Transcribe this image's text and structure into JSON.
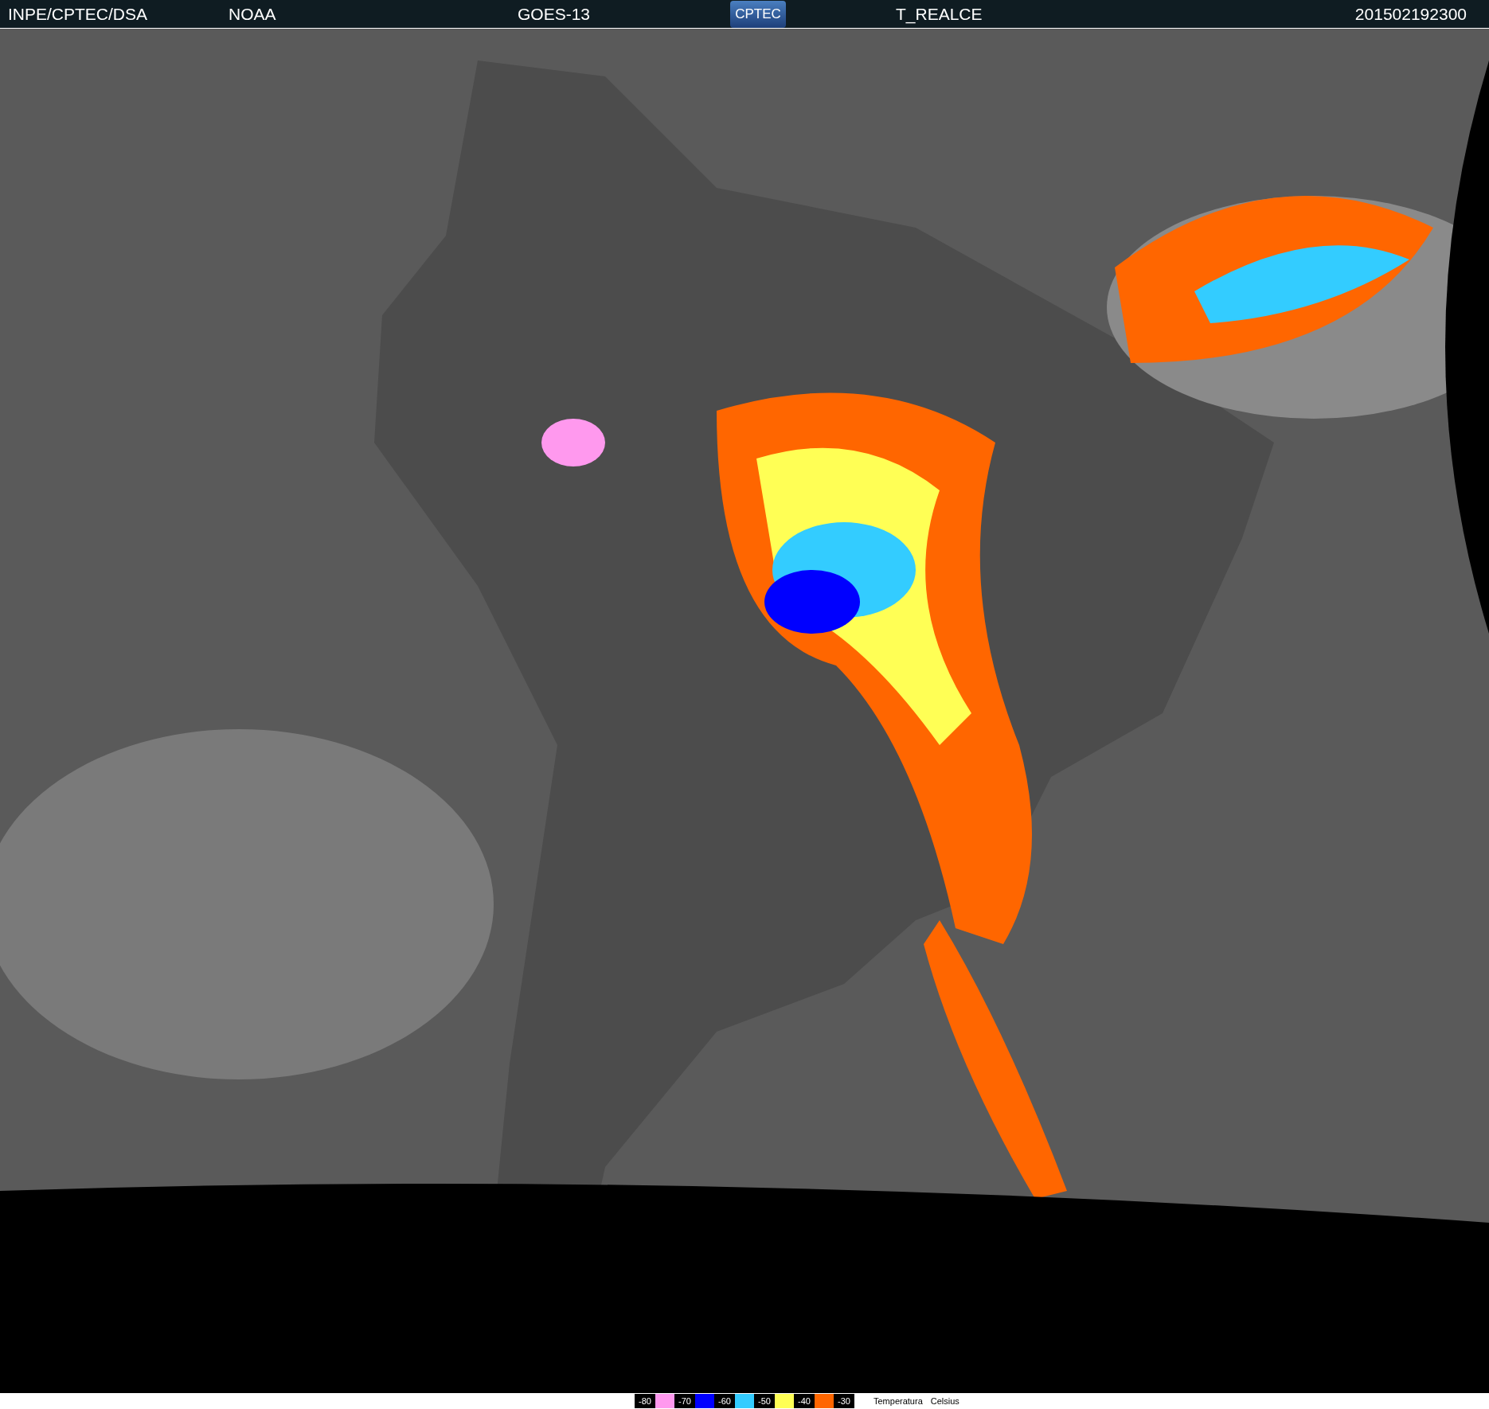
{
  "header": {
    "source": "INPE/CPTEC/DSA",
    "agency": "NOAA",
    "satellite": "GOES-13",
    "logo": "CPTEC",
    "product": "T_REALCE",
    "timestamp": "201502192300"
  },
  "legend": {
    "items": [
      {
        "label": "-80",
        "color": "#ff99ee"
      },
      {
        "label": "-70",
        "color": "#0000ff"
      },
      {
        "label": "-60",
        "color": "#33ccff"
      },
      {
        "label": "-50",
        "color": "#ffff55"
      },
      {
        "label": "-40",
        "color": "#ff6600"
      },
      {
        "label": "-30"
      }
    ],
    "caption": "Temperatura",
    "unit": "Celsius"
  }
}
